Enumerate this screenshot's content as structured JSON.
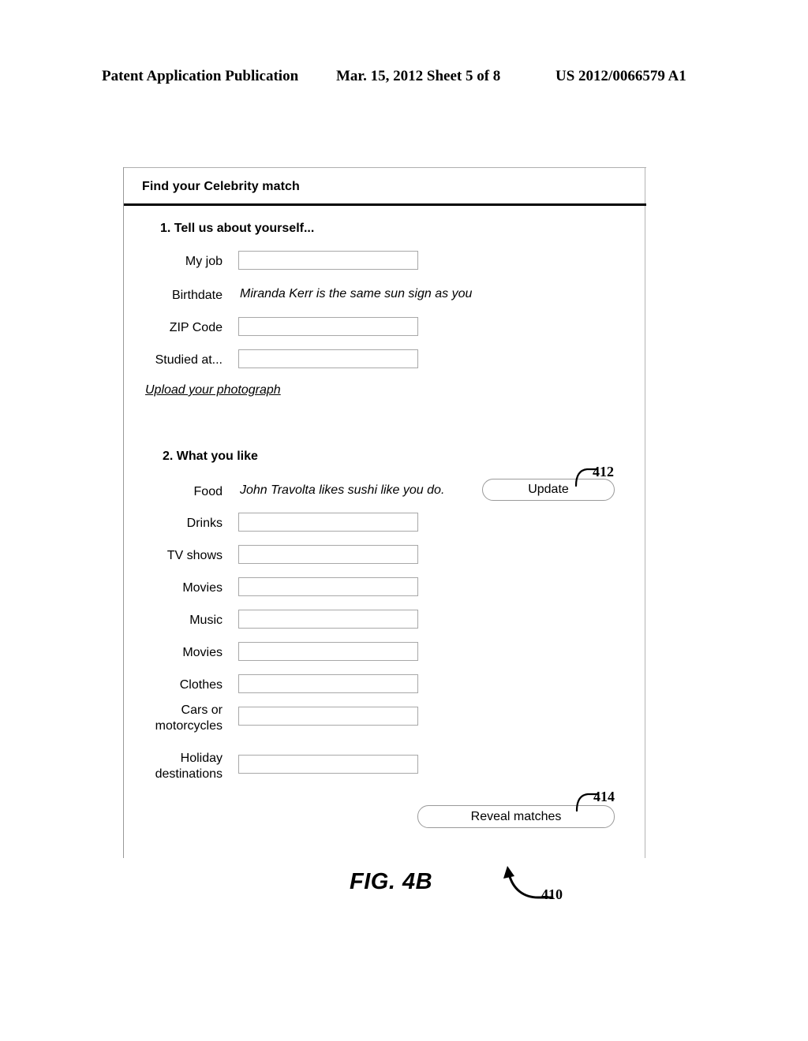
{
  "publication_header": {
    "left": "Patent Application Publication",
    "middle": "Mar. 15, 2012  Sheet 5 of 8",
    "right": "US 2012/0066579 A1"
  },
  "panel": {
    "title": "Find your Celebrity match"
  },
  "section1": {
    "heading": "1. Tell us about yourself...",
    "rows": [
      {
        "label": "My job",
        "type": "input",
        "value": ""
      },
      {
        "label": "Birthdate",
        "type": "text",
        "value": "Miranda Kerr is the same sun sign as you"
      },
      {
        "label": "ZIP Code",
        "type": "input",
        "value": ""
      },
      {
        "label": "Studied at...",
        "type": "input",
        "value": ""
      }
    ],
    "upload_link": "Upload your photograph"
  },
  "section2": {
    "heading": "2. What you like",
    "rows": [
      {
        "label": "Food",
        "type": "text",
        "value": "John Travolta likes sushi like you do."
      },
      {
        "label": "Drinks",
        "type": "input",
        "value": ""
      },
      {
        "label": "TV shows",
        "type": "input",
        "value": ""
      },
      {
        "label": "Movies",
        "type": "input",
        "value": ""
      },
      {
        "label": "Music",
        "type": "input",
        "value": ""
      },
      {
        "label": "Movies",
        "type": "input",
        "value": ""
      },
      {
        "label": "Clothes",
        "type": "input",
        "value": ""
      },
      {
        "label": "Cars or motorcycles",
        "type": "input",
        "value": ""
      },
      {
        "label": "Holiday destinations",
        "type": "input",
        "value": ""
      }
    ],
    "update_button": "Update",
    "reveal_button": "Reveal matches"
  },
  "callouts": {
    "update": "412",
    "reveal": "414",
    "figure": "410"
  },
  "figure_caption": "FIG. 4B"
}
